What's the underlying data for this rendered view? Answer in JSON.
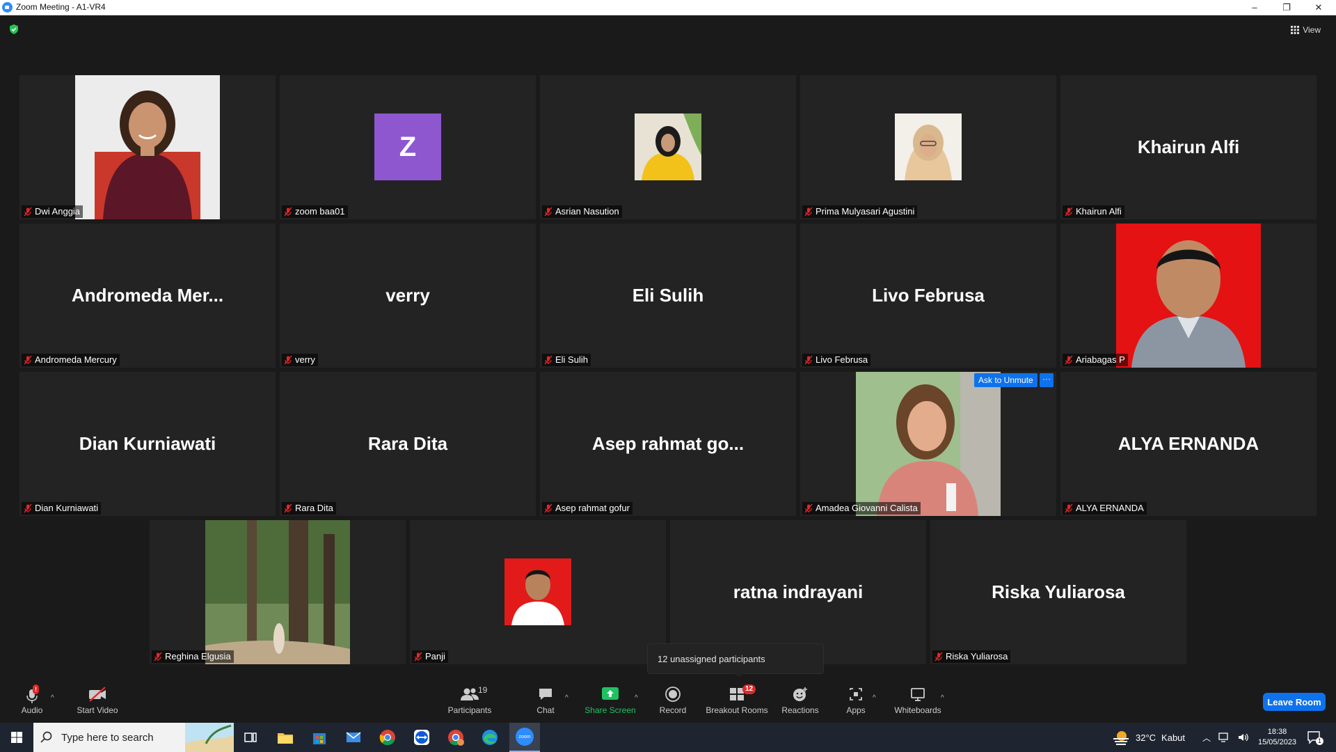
{
  "window": {
    "title": "Zoom Meeting - A1-VR4",
    "minimize": "–",
    "restore": "❐",
    "close": "✕"
  },
  "meeting": {
    "view_label": "View",
    "tiles": [
      {
        "label": "Dwi Anggia",
        "big": "",
        "kind": "photo-woman-red"
      },
      {
        "label": "zoom baa01",
        "big": "",
        "kind": "avatar",
        "avatar_letter": "Z"
      },
      {
        "label": "Asrian Nasution",
        "big": "",
        "kind": "photo-small-yellow"
      },
      {
        "label": "Prima Mulyasari Agustini",
        "big": "",
        "kind": "photo-small-hijab"
      },
      {
        "label": "Khairun Alfi",
        "big": "Khairun Alfi",
        "kind": "name"
      },
      {
        "label": "Andromeda Mercury",
        "big": "Andromeda  Mer...",
        "kind": "name"
      },
      {
        "label": "verry",
        "big": "verry",
        "kind": "name"
      },
      {
        "label": "Eli Sulih",
        "big": "Eli Sulih",
        "kind": "name"
      },
      {
        "label": "Livo Februsa",
        "big": "Livo Februsa",
        "kind": "name"
      },
      {
        "label": "Ariabagas P",
        "big": "",
        "kind": "photo-man-red"
      },
      {
        "label": "Dian Kurniawati",
        "big": "Dian Kurniawati",
        "kind": "name"
      },
      {
        "label": "Rara Dita",
        "big": "Rara Dita",
        "kind": "name"
      },
      {
        "label": "Asep rahmat gofur",
        "big": "Asep  rahmat  go...",
        "kind": "name"
      },
      {
        "label": "Amadea Giovanni Calista",
        "big": "",
        "kind": "photo-woman-pink"
      },
      {
        "label": "ALYA ERNANDA",
        "big": "ALYA ERNANDA",
        "kind": "name"
      },
      {
        "label": "Reghina Elgusia",
        "big": "",
        "kind": "photo-forest"
      },
      {
        "label": "Panji",
        "big": "",
        "kind": "photo-small-red"
      },
      {
        "label": "",
        "big": "ratna indrayani",
        "kind": "name"
      },
      {
        "label": "Riska Yuliarosa",
        "big": "Riska Yuliarosa",
        "kind": "name"
      }
    ],
    "ask_to_unmute": "Ask to Unmute",
    "more": "···",
    "tooltip": "12 unassigned participants"
  },
  "toolbar": {
    "audio": "Audio",
    "audio_alert": "!",
    "start_video": "Start Video",
    "participants": "Participants",
    "participants_count": "19",
    "chat": "Chat",
    "share_screen": "Share Screen",
    "record": "Record",
    "breakout_rooms": "Breakout Rooms",
    "breakout_badge": "12",
    "reactions": "Reactions",
    "apps": "Apps",
    "whiteboards": "Whiteboards",
    "caret": "^",
    "leave_room": "Leave Room"
  },
  "taskbar": {
    "search_placeholder": "Type here to search",
    "weather_temp": "32°C",
    "weather_desc": "Kabut",
    "time": "18:38",
    "date": "15/05/2023",
    "notif_count": "1",
    "zoom_icon_text": "zoom"
  },
  "colors": {
    "accent_blue": "#0e72ed",
    "mute_red": "#e02828",
    "share_green": "#1fc262",
    "avatar_purple": "#8e57cf"
  }
}
